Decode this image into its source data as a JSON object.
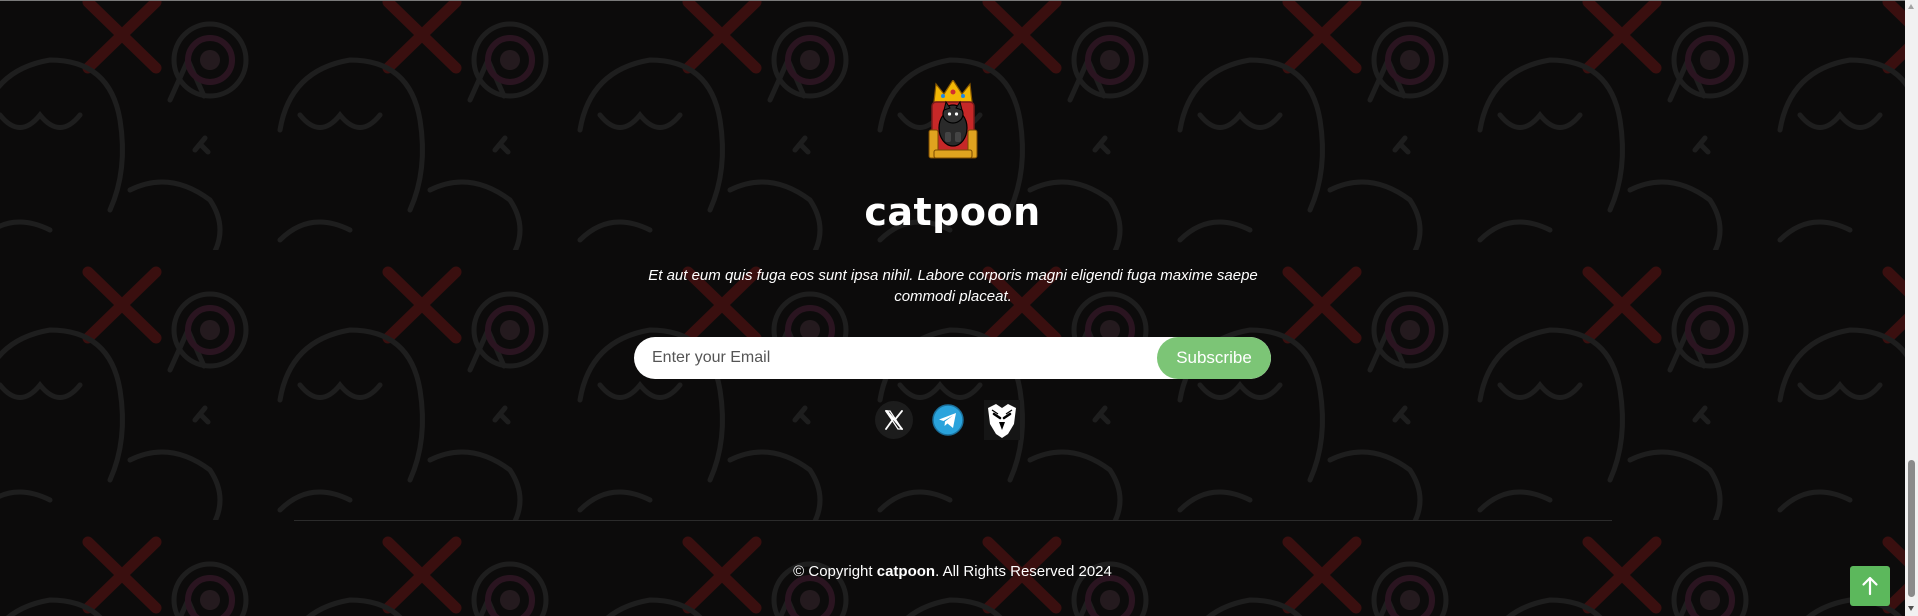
{
  "footer": {
    "logo_icon": "cat-king-on-throne",
    "brand_name": "catpoon",
    "tagline": "Et aut eum quis fuga eos sunt ipsa nihil. Labore corporis magni eligendi fuga maxime saepe commodi placeat.",
    "subscribe": {
      "placeholder": "Enter your Email",
      "button_label": "Subscribe"
    },
    "socials": [
      {
        "icon": "x-icon",
        "label": "X"
      },
      {
        "icon": "telegram-icon",
        "label": "Telegram"
      },
      {
        "icon": "eagle-icon",
        "label": "Eagle"
      }
    ],
    "copyright": {
      "prefix": "© Copyright ",
      "brand": "catpoon",
      "suffix": ". All Rights Reserved 2024"
    }
  },
  "back_to_top": {
    "icon": "arrow-up-icon"
  },
  "colors": {
    "background": "#0c0b0b",
    "accent": "#7cc576",
    "back_to_top": "#5cb85c",
    "text": "#ffffff"
  }
}
